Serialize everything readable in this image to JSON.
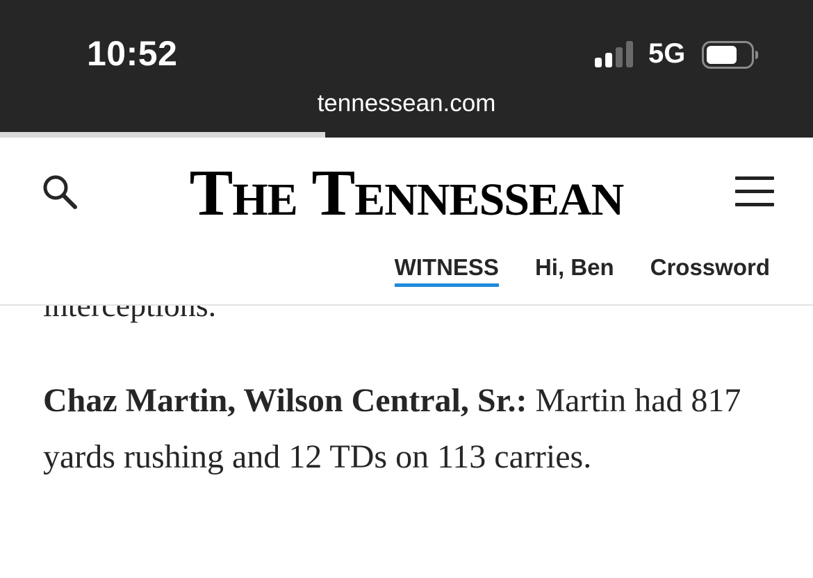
{
  "status_bar": {
    "time": "10:52",
    "network": "5G",
    "signal_icon": "cellular-signal-icon",
    "signal_bars_active": 2,
    "signal_bars_total": 4,
    "battery_icon": "battery-icon",
    "battery_level": 0.7
  },
  "browser": {
    "url": "tennessean.com",
    "load_progress": 0.4
  },
  "header": {
    "search_icon": "search-icon",
    "masthead": "The Tennessean",
    "menu_icon": "hamburger-menu-icon",
    "nav": {
      "witness": "WITNESS",
      "greeting": "Hi, Ben",
      "crossword": "Crossword"
    },
    "accent_color": "#1d8cdc"
  },
  "article": {
    "previous_paragraph_tail": "interceptions.",
    "player_heading": "Chaz Martin, Wilson Central, Sr.:",
    "player_text": " Martin had 817 yards rushing and 12 TDs on 113 carries."
  }
}
